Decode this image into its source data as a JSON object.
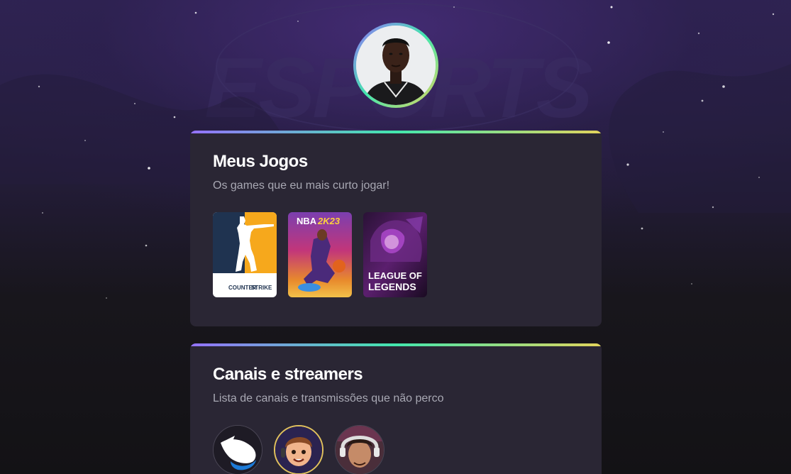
{
  "profile": {
    "avatar_alt": "Avatar"
  },
  "games_section": {
    "title": "Meus Jogos",
    "subtitle": "Os games que eu mais curto jogar!",
    "games": [
      {
        "name": "counter-strike",
        "label_top": "COUNTER",
        "label_bottom": "STRIKE"
      },
      {
        "name": "nba-2k23",
        "label_top": "NBA",
        "label_bottom": "2K23"
      },
      {
        "name": "league-of-legends",
        "label_top": "LEAGUE OF",
        "label_bottom": "LEGENDS"
      }
    ]
  },
  "channels_section": {
    "title": "Canais e streamers",
    "subtitle": "Lista de canais e transmissões que não perco"
  },
  "colors": {
    "accent_start": "#9572fc",
    "accent_mid": "#43e7ad",
    "accent_end": "#e1d55d",
    "card_bg": "#2a2634",
    "subtitle": "#a8a8b3"
  }
}
